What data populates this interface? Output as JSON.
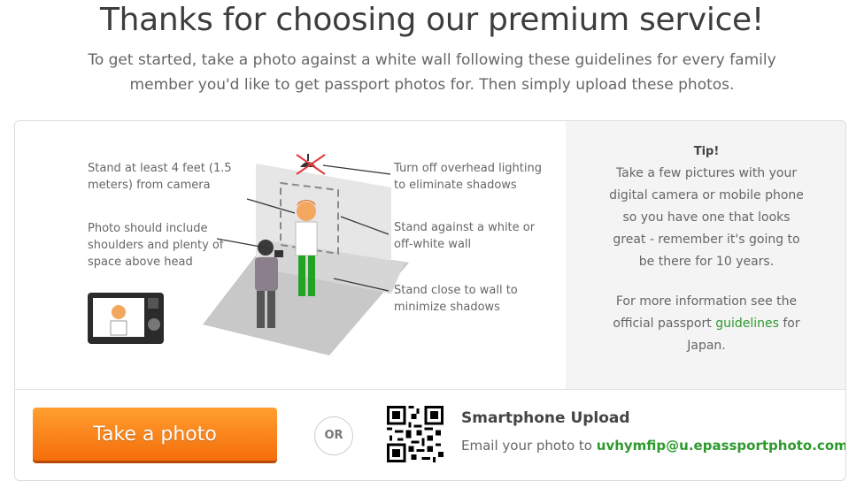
{
  "header": {
    "title": "Thanks for choosing our premium service!",
    "subtitle": "To get started, take a photo against a white wall following these guidelines for every family member you'd like to get passport photos for. Then simply upload these photos."
  },
  "illustration": {
    "note_distance": "Stand at least 4 feet (1.5 meters) from camera",
    "note_framing": "Photo should include shoulders and plenty of space above head",
    "note_lighting": "Turn off overhead lighting to eliminate shadows",
    "note_wall": "Stand against a white or off-white wall",
    "note_close": "Stand close to wall to minimize shadows"
  },
  "tip": {
    "title": "Tip!",
    "body": "Take a few pictures with your digital camera or mobile phone so you have one that looks great - remember it's going to be there for 10 years.",
    "more_prefix": "For more information see the official passport",
    "more_link": "guidelines",
    "more_suffix": "for Japan."
  },
  "actions": {
    "take_photo_label": "Take a photo",
    "or_label": "OR",
    "smartphone_title": "Smartphone Upload",
    "email_prefix": "Email your photo to",
    "email_address": "uvhymfip@u.epassportphoto.com"
  },
  "colors": {
    "accent_orange": "#f56d0b",
    "link_green": "#2e9a2e",
    "tip_bg": "#f4f4f4"
  }
}
